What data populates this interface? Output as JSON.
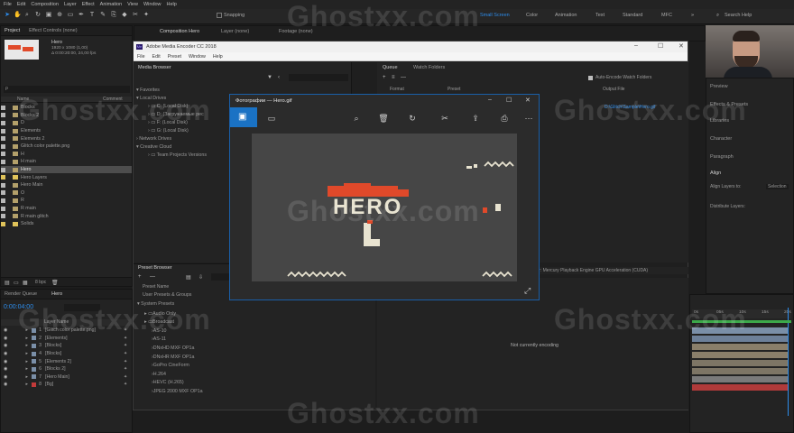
{
  "menu": [
    "File",
    "Edit",
    "Composition",
    "Layer",
    "Effect",
    "Animation",
    "View",
    "Window",
    "Help"
  ],
  "toolbar": {
    "snapping": "Snapping",
    "workspaces": [
      {
        "label": "Small Screen",
        "active": true
      },
      {
        "label": "Color",
        "active": false
      },
      {
        "label": "Animation",
        "active": false
      },
      {
        "label": "Text",
        "active": false
      },
      {
        "label": "Standard",
        "active": false
      },
      {
        "label": "MFC",
        "active": false
      }
    ],
    "search_placeholder": "Search Help"
  },
  "project": {
    "tabs": [
      "Project",
      "Effect Controls (none)"
    ],
    "comp_name": "Hero",
    "comp_info1": "1920 x 1080 (1,00)",
    "comp_info2": "Δ 0:00:20:00, 24,00 fps",
    "search_placeholder": "ρ",
    "col_name": "Name",
    "col_comment": "Comment",
    "items": [
      {
        "label": "Blocks",
        "color": "#b8b8b8",
        "type": "comp"
      },
      {
        "label": "Blocks 2",
        "color": "#b8b8b8",
        "type": "comp"
      },
      {
        "label": "D",
        "color": "#b8b8b8",
        "type": "comp"
      },
      {
        "label": "Elements",
        "color": "#b8b8b8",
        "type": "comp"
      },
      {
        "label": "Elements 2",
        "color": "#b8b8b8",
        "type": "comp"
      },
      {
        "label": "Glitch color palette.png",
        "color": "#b8b8b8",
        "type": "file"
      },
      {
        "label": "H",
        "color": "#b8b8b8",
        "type": "comp"
      },
      {
        "label": "H main",
        "color": "#b8b8b8",
        "type": "comp"
      },
      {
        "label": "Hero",
        "color": "#b8b8b8",
        "type": "comp",
        "selected": true
      },
      {
        "label": "Hero Layers",
        "color": "#e0c35a",
        "type": "folder"
      },
      {
        "label": "Hero Main",
        "color": "#b8b8b8",
        "type": "comp"
      },
      {
        "label": "O",
        "color": "#b8b8b8",
        "type": "comp"
      },
      {
        "label": "R",
        "color": "#b8b8b8",
        "type": "comp"
      },
      {
        "label": "R main",
        "color": "#b8b8b8",
        "type": "comp"
      },
      {
        "label": "R main glitch",
        "color": "#b8b8b8",
        "type": "comp"
      },
      {
        "label": "Solids",
        "color": "#e0c35a",
        "type": "folder"
      }
    ],
    "bpc": "8 bpc"
  },
  "comp_tabs": [
    "Composition Hero",
    "Layer (none)",
    "Footage (none)"
  ],
  "ame": {
    "title": "Adobe Media Encoder CC 2018",
    "menu": [
      "File",
      "Edit",
      "Preset",
      "Window",
      "Help"
    ],
    "media_browser": "Media Browser",
    "favorites": "Favorites",
    "local_drives": "Local Drives",
    "drives": [
      "C: (Local Disk)",
      "D: (Загружаемые рес",
      "F: (Local Disk)",
      "G: (Local Disk)"
    ],
    "network_drives": "Network Drives",
    "creative_cloud": "Creative Cloud",
    "team_projects": "Team Projects Versions",
    "queue_tab": "Queue",
    "watch_tab": "Watch Folders",
    "auto_encode": "Auto-Encode Watch Folders",
    "col_format": "Format",
    "col_preset": "Preset",
    "col_output": "Output File",
    "output_path": "D:\\Glitch\\Sample\\Hero.gif",
    "renderer": "Renderer: Mercury Playback Engine GPU Acceleration (CUDA)",
    "not_encoding": "Not currently encoding",
    "preset_browser": "Preset Browser",
    "preset_name": "Preset Name",
    "user_presets": "User Presets & Groups",
    "system_presets": "System Presets",
    "presets": [
      "Audio Only",
      "Broadcast",
      "AS-10",
      "AS-11",
      "DNxHD MXF OP1a",
      "DNxHR MXF OP1a",
      "GoPro CineForm",
      "H.264",
      "HEVC (H.265)",
      "JPEG 2000 MXF OP1a"
    ]
  },
  "photos": {
    "title": "Фотографии — Hero.gif",
    "gif_text": "HERO"
  },
  "timeline": {
    "render_queue": "Render Queue",
    "hero_tab": "Hero",
    "timecode": "0:00:04:00",
    "layer_name_col": "Layer Name",
    "layers": [
      {
        "num": "1",
        "label": "[Glitch color palette.png]",
        "color": "#7a8fa8"
      },
      {
        "num": "2",
        "label": "[Elements]",
        "color": "#7a8fa8"
      },
      {
        "num": "3",
        "label": "[Blocks]",
        "color": "#7a8fa8"
      },
      {
        "num": "4",
        "label": "[Blocks]",
        "color": "#7a8fa8"
      },
      {
        "num": "5",
        "label": "[Elements 2]",
        "color": "#7a8fa8"
      },
      {
        "num": "6",
        "label": "[Blocks 2]",
        "color": "#7a8fa8"
      },
      {
        "num": "7",
        "label": "[Hero Main]",
        "color": "#7a8fa8"
      },
      {
        "num": "8",
        "label": "[Bg]",
        "color": "#c23a3a"
      }
    ],
    "ruler": [
      "0s",
      "05s",
      "10s",
      "15s",
      "20s"
    ]
  },
  "right_panels": [
    "Preview",
    "Effects & Presets",
    "Libraries",
    "Character",
    "Paragraph"
  ],
  "align": {
    "title": "Align",
    "align_to": "Align Layers to:",
    "selection": "Selection",
    "distribute": "Distribute Layers:"
  },
  "watermark": "Ghostxx.com"
}
